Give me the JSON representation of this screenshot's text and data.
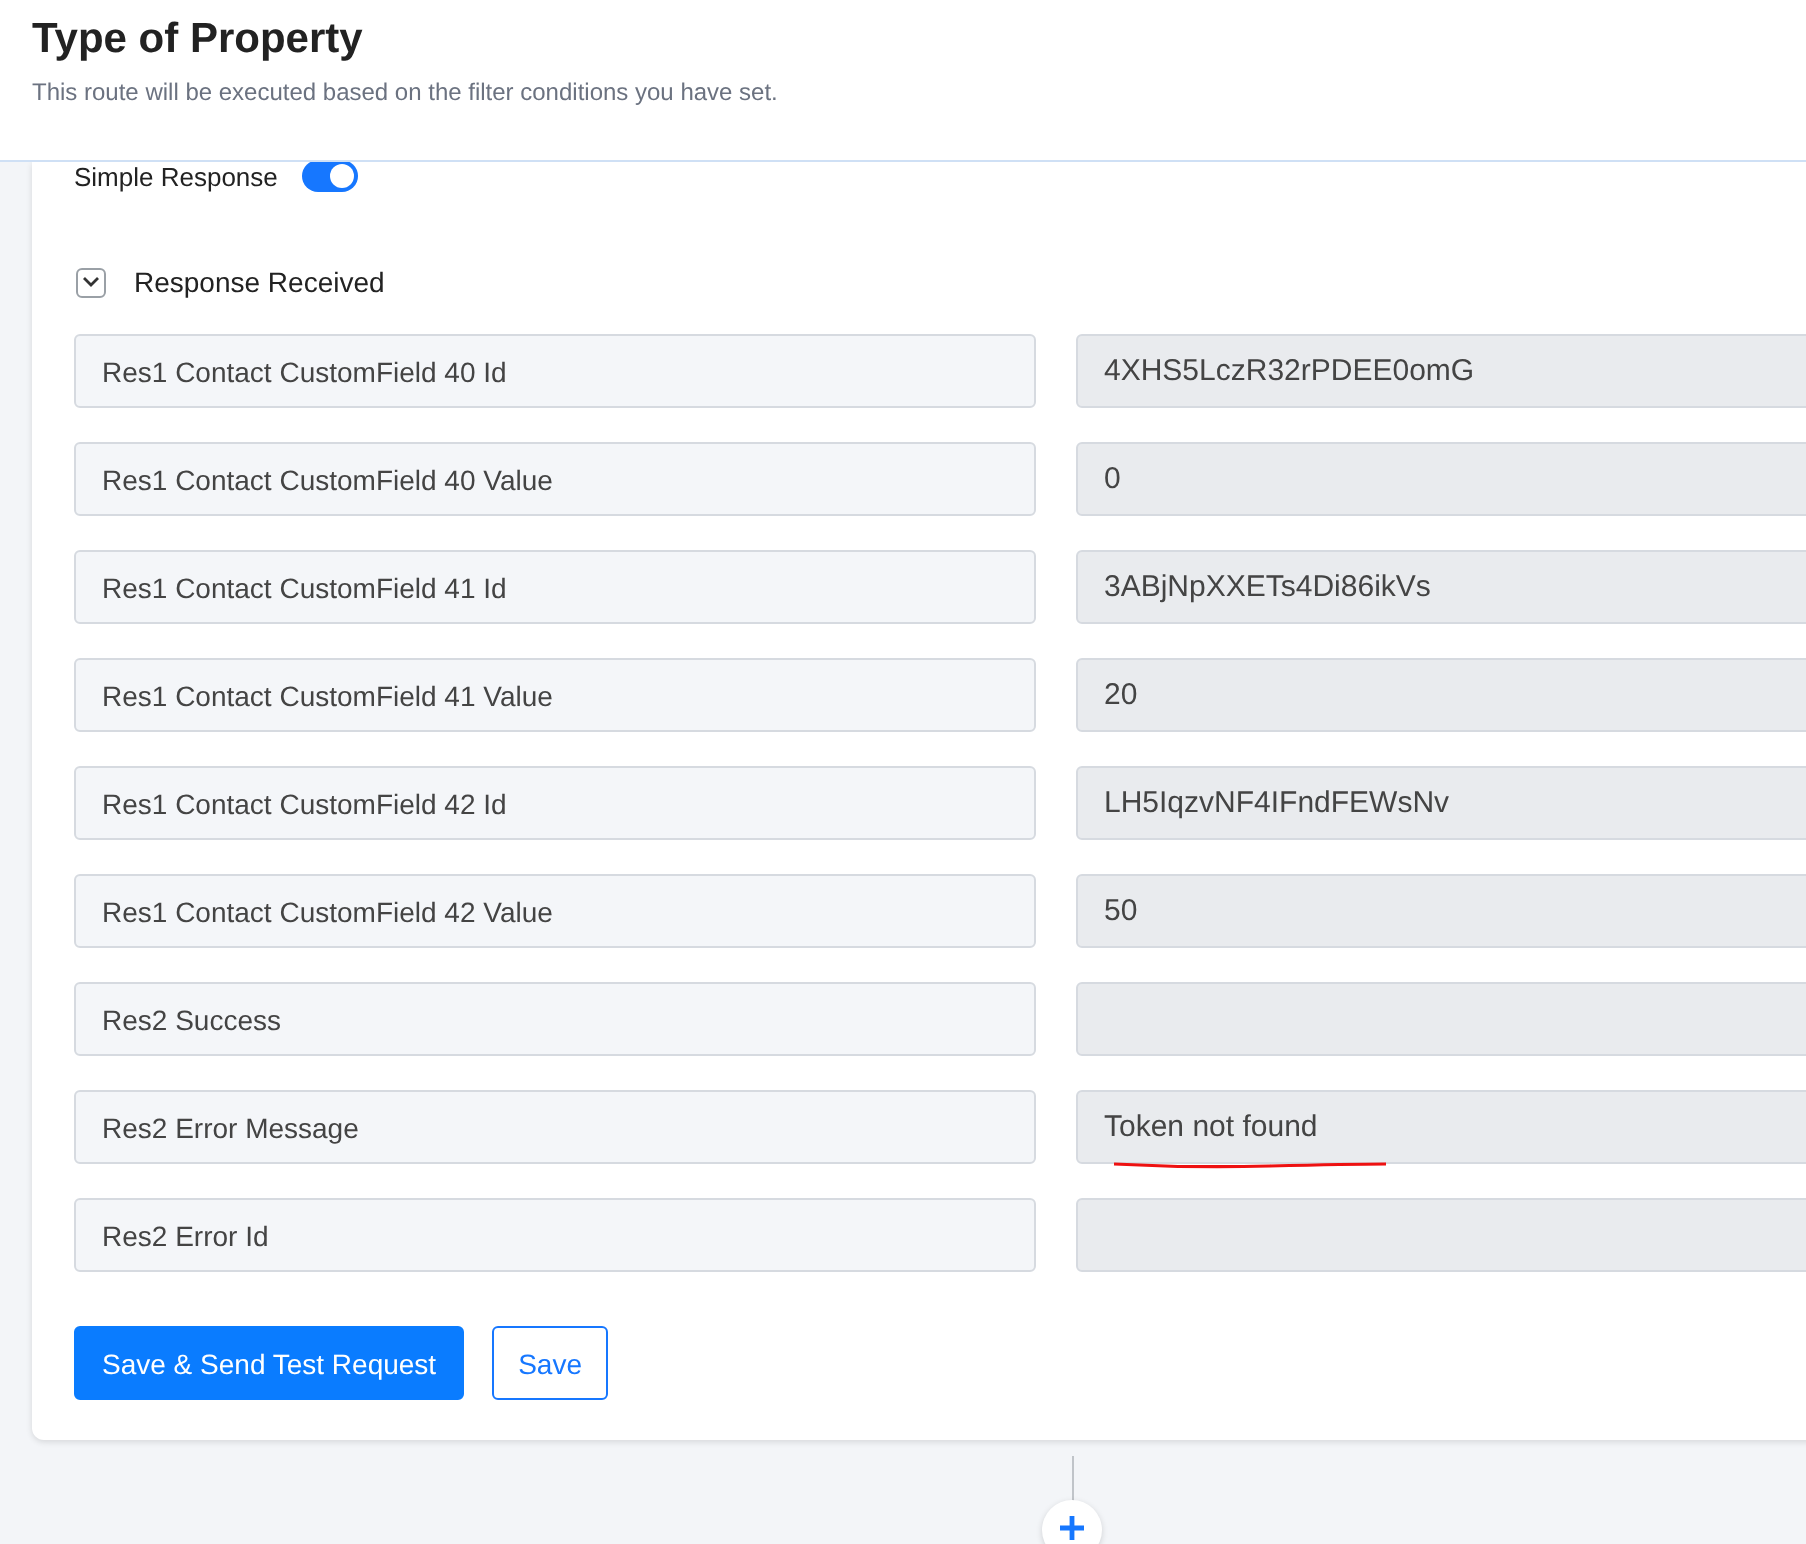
{
  "header": {
    "title": "Type of Property",
    "subtitle": "This route will be executed based on the filter conditions you have set."
  },
  "simple_response": {
    "label": "Simple Response",
    "on": true
  },
  "section": {
    "label": "Response Received",
    "expanded": true
  },
  "rows": [
    {
      "label": "Res1 Contact CustomField 40 Id",
      "value": "4XHS5LczR32rPDEE0omG",
      "underlined": false
    },
    {
      "label": "Res1 Contact CustomField 40 Value",
      "value": "0",
      "underlined": false
    },
    {
      "label": "Res1 Contact CustomField 41 Id",
      "value": "3ABjNpXXETs4Di86ikVs",
      "underlined": false
    },
    {
      "label": "Res1 Contact CustomField 41 Value",
      "value": "20",
      "underlined": false
    },
    {
      "label": "Res1 Contact CustomField 42 Id",
      "value": "LH5IqzvNF4IFndFEWsNv",
      "underlined": false
    },
    {
      "label": "Res1 Contact CustomField 42 Value",
      "value": "50",
      "underlined": false
    },
    {
      "label": "Res2 Success",
      "value": "",
      "underlined": false
    },
    {
      "label": "Res2 Error Message",
      "value": "Token not found",
      "underlined": true
    },
    {
      "label": "Res2 Error Id",
      "value": "",
      "underlined": false
    }
  ],
  "buttons": [
    {
      "label": "Save & Send Test Request",
      "kind": "primary"
    },
    {
      "label": "Save",
      "kind": "outline"
    }
  ]
}
